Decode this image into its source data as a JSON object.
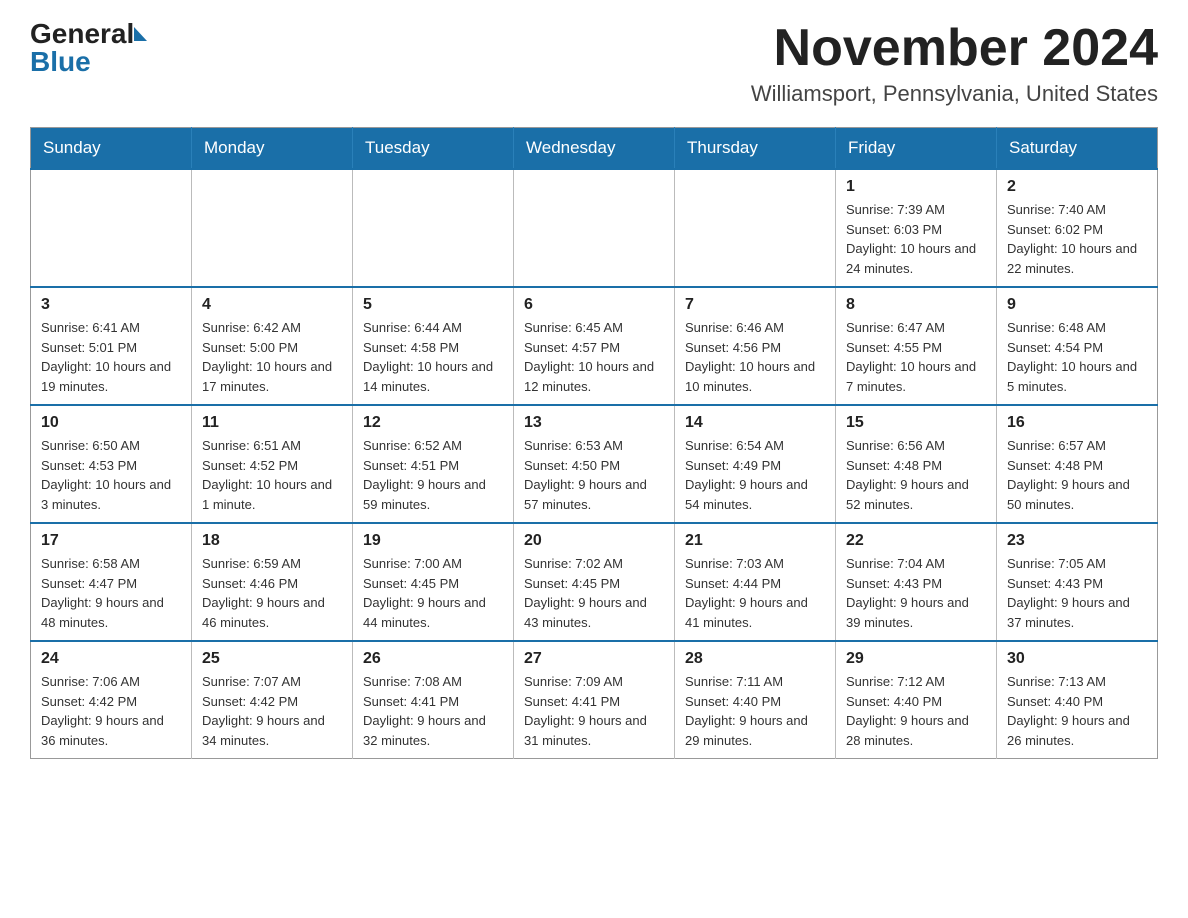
{
  "logo": {
    "general": "General",
    "blue": "Blue"
  },
  "header": {
    "title": "November 2024",
    "subtitle": "Williamsport, Pennsylvania, United States"
  },
  "days_of_week": [
    "Sunday",
    "Monday",
    "Tuesday",
    "Wednesday",
    "Thursday",
    "Friday",
    "Saturday"
  ],
  "weeks": [
    [
      {
        "day": "",
        "info": ""
      },
      {
        "day": "",
        "info": ""
      },
      {
        "day": "",
        "info": ""
      },
      {
        "day": "",
        "info": ""
      },
      {
        "day": "",
        "info": ""
      },
      {
        "day": "1",
        "info": "Sunrise: 7:39 AM\nSunset: 6:03 PM\nDaylight: 10 hours and 24 minutes."
      },
      {
        "day": "2",
        "info": "Sunrise: 7:40 AM\nSunset: 6:02 PM\nDaylight: 10 hours and 22 minutes."
      }
    ],
    [
      {
        "day": "3",
        "info": "Sunrise: 6:41 AM\nSunset: 5:01 PM\nDaylight: 10 hours and 19 minutes."
      },
      {
        "day": "4",
        "info": "Sunrise: 6:42 AM\nSunset: 5:00 PM\nDaylight: 10 hours and 17 minutes."
      },
      {
        "day": "5",
        "info": "Sunrise: 6:44 AM\nSunset: 4:58 PM\nDaylight: 10 hours and 14 minutes."
      },
      {
        "day": "6",
        "info": "Sunrise: 6:45 AM\nSunset: 4:57 PM\nDaylight: 10 hours and 12 minutes."
      },
      {
        "day": "7",
        "info": "Sunrise: 6:46 AM\nSunset: 4:56 PM\nDaylight: 10 hours and 10 minutes."
      },
      {
        "day": "8",
        "info": "Sunrise: 6:47 AM\nSunset: 4:55 PM\nDaylight: 10 hours and 7 minutes."
      },
      {
        "day": "9",
        "info": "Sunrise: 6:48 AM\nSunset: 4:54 PM\nDaylight: 10 hours and 5 minutes."
      }
    ],
    [
      {
        "day": "10",
        "info": "Sunrise: 6:50 AM\nSunset: 4:53 PM\nDaylight: 10 hours and 3 minutes."
      },
      {
        "day": "11",
        "info": "Sunrise: 6:51 AM\nSunset: 4:52 PM\nDaylight: 10 hours and 1 minute."
      },
      {
        "day": "12",
        "info": "Sunrise: 6:52 AM\nSunset: 4:51 PM\nDaylight: 9 hours and 59 minutes."
      },
      {
        "day": "13",
        "info": "Sunrise: 6:53 AM\nSunset: 4:50 PM\nDaylight: 9 hours and 57 minutes."
      },
      {
        "day": "14",
        "info": "Sunrise: 6:54 AM\nSunset: 4:49 PM\nDaylight: 9 hours and 54 minutes."
      },
      {
        "day": "15",
        "info": "Sunrise: 6:56 AM\nSunset: 4:48 PM\nDaylight: 9 hours and 52 minutes."
      },
      {
        "day": "16",
        "info": "Sunrise: 6:57 AM\nSunset: 4:48 PM\nDaylight: 9 hours and 50 minutes."
      }
    ],
    [
      {
        "day": "17",
        "info": "Sunrise: 6:58 AM\nSunset: 4:47 PM\nDaylight: 9 hours and 48 minutes."
      },
      {
        "day": "18",
        "info": "Sunrise: 6:59 AM\nSunset: 4:46 PM\nDaylight: 9 hours and 46 minutes."
      },
      {
        "day": "19",
        "info": "Sunrise: 7:00 AM\nSunset: 4:45 PM\nDaylight: 9 hours and 44 minutes."
      },
      {
        "day": "20",
        "info": "Sunrise: 7:02 AM\nSunset: 4:45 PM\nDaylight: 9 hours and 43 minutes."
      },
      {
        "day": "21",
        "info": "Sunrise: 7:03 AM\nSunset: 4:44 PM\nDaylight: 9 hours and 41 minutes."
      },
      {
        "day": "22",
        "info": "Sunrise: 7:04 AM\nSunset: 4:43 PM\nDaylight: 9 hours and 39 minutes."
      },
      {
        "day": "23",
        "info": "Sunrise: 7:05 AM\nSunset: 4:43 PM\nDaylight: 9 hours and 37 minutes."
      }
    ],
    [
      {
        "day": "24",
        "info": "Sunrise: 7:06 AM\nSunset: 4:42 PM\nDaylight: 9 hours and 36 minutes."
      },
      {
        "day": "25",
        "info": "Sunrise: 7:07 AM\nSunset: 4:42 PM\nDaylight: 9 hours and 34 minutes."
      },
      {
        "day": "26",
        "info": "Sunrise: 7:08 AM\nSunset: 4:41 PM\nDaylight: 9 hours and 32 minutes."
      },
      {
        "day": "27",
        "info": "Sunrise: 7:09 AM\nSunset: 4:41 PM\nDaylight: 9 hours and 31 minutes."
      },
      {
        "day": "28",
        "info": "Sunrise: 7:11 AM\nSunset: 4:40 PM\nDaylight: 9 hours and 29 minutes."
      },
      {
        "day": "29",
        "info": "Sunrise: 7:12 AM\nSunset: 4:40 PM\nDaylight: 9 hours and 28 minutes."
      },
      {
        "day": "30",
        "info": "Sunrise: 7:13 AM\nSunset: 4:40 PM\nDaylight: 9 hours and 26 minutes."
      }
    ]
  ]
}
